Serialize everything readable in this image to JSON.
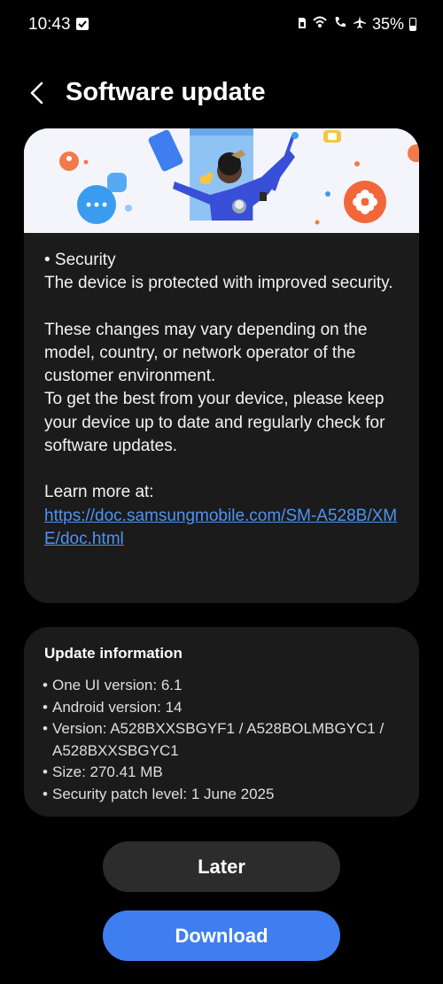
{
  "status_bar": {
    "time": "10:43",
    "battery_percent": "35%"
  },
  "header": {
    "title": "Software update"
  },
  "notes": {
    "security_heading": "• Security",
    "security_body": "The device is protected with improved security.",
    "disclaimer": "These changes may vary depending on the model, country, or network operator of the customer environment.",
    "advice": "To get the best from your device, please keep your device up to date and regularly check for software updates.",
    "learn_more_label": "Learn more at:",
    "learn_more_link": "https://doc.samsungmobile.com/SM-A528B/XME/doc.html"
  },
  "update_info": {
    "title": "Update information",
    "items": [
      "One UI version: 6.1",
      "Android version: 14",
      "Version: A528BXXSBGYF1 / A528BOLMBGYC1 / A528BXXSBGYC1",
      "Size: 270.41 MB",
      "Security patch level: 1 June 2025"
    ]
  },
  "buttons": {
    "later": "Later",
    "download": "Download"
  },
  "colors": {
    "background": "#000000",
    "card": "#1b1b1b",
    "link": "#4e93f5",
    "primary_button": "#3f7ef0",
    "secondary_button": "#2c2c2c"
  }
}
